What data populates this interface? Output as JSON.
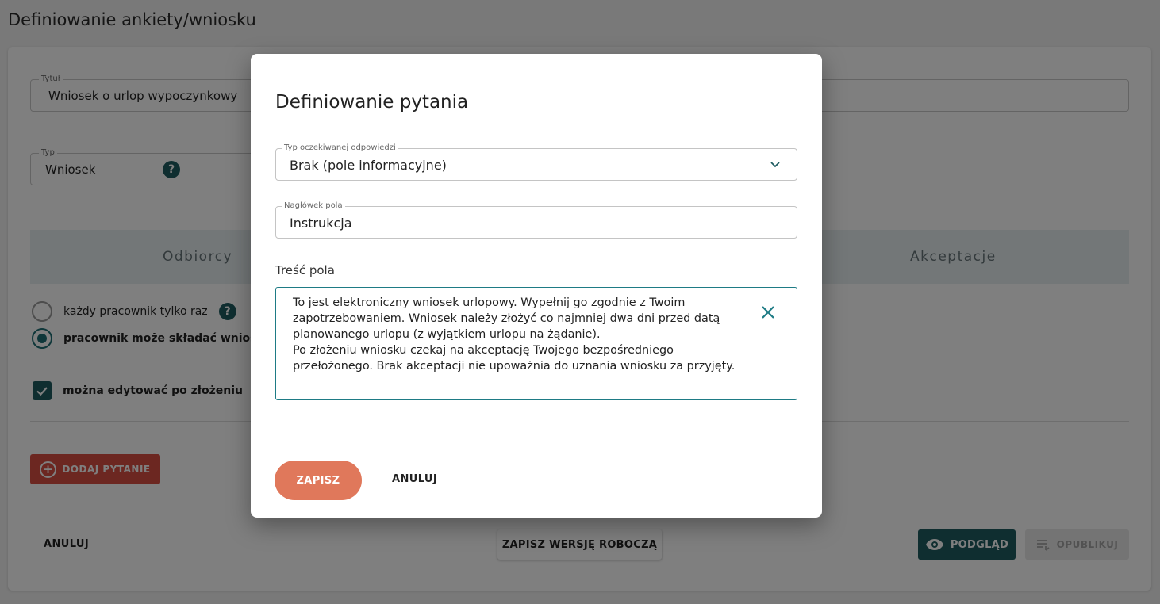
{
  "page": {
    "title": "Definiowanie ankiety/wniosku"
  },
  "form": {
    "title_field": {
      "legend": "Tytuł",
      "value": "Wniosek o urlop wypoczynkowy"
    },
    "type_field": {
      "legend": "Typ",
      "value": "Wniosek"
    }
  },
  "tabs": [
    {
      "label": "Odbiorcy"
    },
    {
      "label": "Akceptacje"
    }
  ],
  "options": {
    "once_label": "każdy pracownik tylko raz",
    "many_label": "pracownik może składać wniosek",
    "editable_label": "można edytować po złożeniu"
  },
  "actions": {
    "add_question": "DODAJ PYTANIE",
    "cancel": "ANULUJ",
    "save_draft": "ZAPISZ WERSJĘ ROBOCZĄ",
    "preview": "PODGLĄD",
    "publish": "OPUBLIKUJ"
  },
  "modal": {
    "title": "Definiowanie pytania",
    "answer_type": {
      "legend": "Typ oczekiwanej odpowiedzi",
      "value": "Brak (pole informacyjne)"
    },
    "field_header": {
      "legend": "Nagłówek pola",
      "value": "Instrukcja"
    },
    "content_label": "Treść pola",
    "content_value": "To jest elektroniczny wniosek urlopowy. Wypełnij go zgodnie z Twoim zapotrzebowaniem. Wniosek należy złożyć co najmniej dwa dni przed datą planowanego urlopu (z wyjątkiem urlopu na żądanie).\nPo złożeniu wniosku czekaj na akceptację Twojego bezpośredniego przełożonego. Brak akceptacji nie upoważnia do uznania wniosku za przyjęty.",
    "save": "ZAPISZ",
    "cancel": "ANULUJ"
  },
  "colors": {
    "primary_teal": "#1e5c61",
    "focus_teal": "#1e7b85",
    "save_orange": "#e0785b",
    "add_red": "#d94f43"
  },
  "icons": {
    "help": "help-circle-icon",
    "chevron": "chevron-down-icon",
    "clear": "close-icon",
    "eye": "eye-icon",
    "publish": "list-icon",
    "add": "plus-circle-icon",
    "check": "check-icon"
  }
}
